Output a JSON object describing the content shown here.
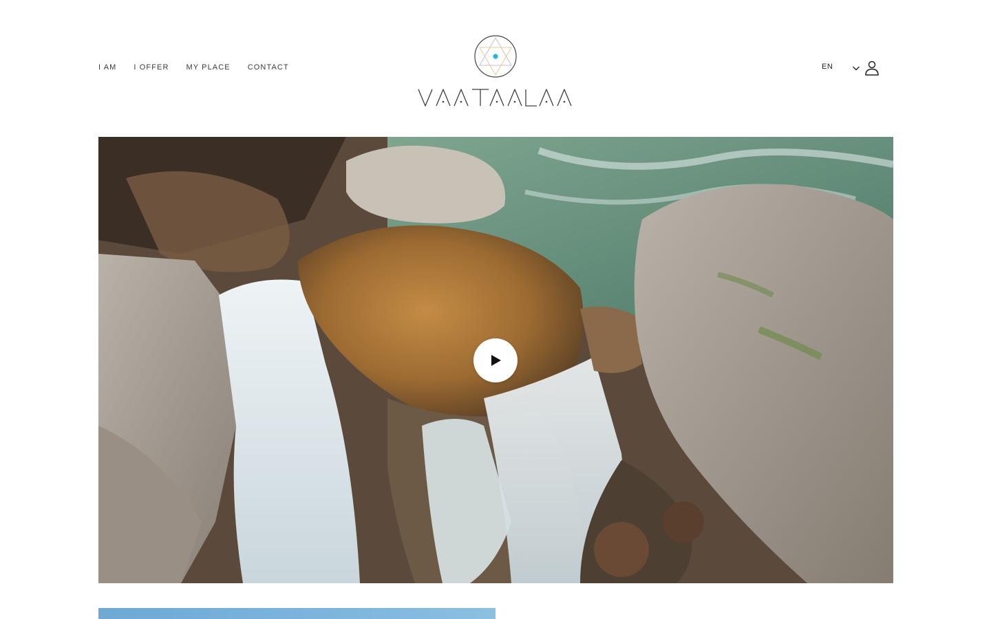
{
  "nav": {
    "items": [
      "I AM",
      "I OFFER",
      "MY PLACE",
      "CONTACT"
    ]
  },
  "brand": {
    "wordmark": "VAATAALAA",
    "accent_color": "#1fb8e0"
  },
  "header_right": {
    "language": "EN",
    "chevron_icon": "chevron-down-icon",
    "account_icon": "user-icon"
  },
  "hero": {
    "media": "video",
    "play_icon": "play-icon"
  }
}
